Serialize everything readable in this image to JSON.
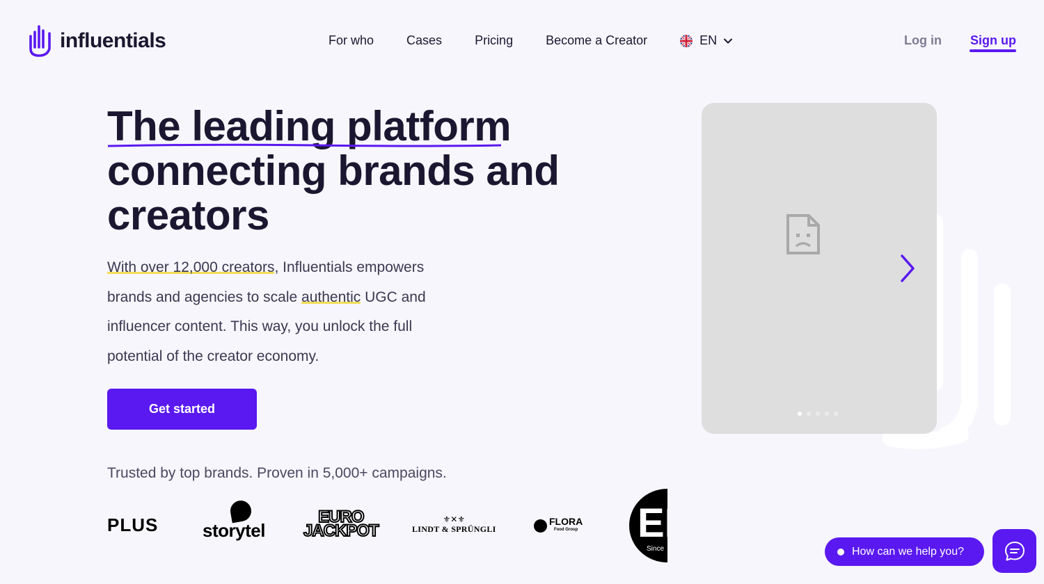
{
  "brand": {
    "name": "influentials",
    "accent": "#5a19f0",
    "highlight": "#f2dd55"
  },
  "nav": {
    "items": [
      "For who",
      "Cases",
      "Pricing",
      "Become a Creator"
    ],
    "language": "EN",
    "login": "Log in",
    "signup": "Sign up"
  },
  "hero": {
    "headline_lines": [
      "The leading platform",
      "connecting brands and",
      "creators"
    ],
    "lead": {
      "part1": "With over 12,000 creators",
      "part2": ", Influentials empowers brands and agencies to scale ",
      "part3": "authentic",
      "part4": " UGC and influencer content. This way, you unlock the full potential of the creator economy."
    },
    "cta": "Get started",
    "trusted": "Trusted by top brands. Proven in 5,000+ campaigns."
  },
  "logos": {
    "plus": "PLUS",
    "storytel": "storytel",
    "euro_line1": "EURO",
    "euro_line2": "JACKPOT",
    "lindt": "LINDT & SPRÜNGLI",
    "flora": "FLORA",
    "flora_sub": "Food Group",
    "ep": "EP",
    "ep_sub": "Since"
  },
  "carousel": {
    "slides": 5,
    "active": 1
  },
  "chat": {
    "prompt": "How can we help you?"
  }
}
